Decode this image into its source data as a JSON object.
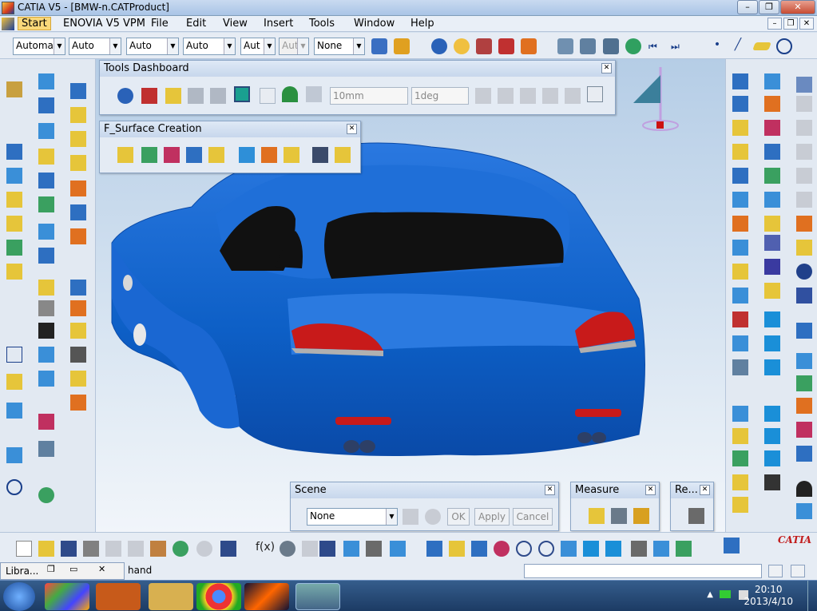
{
  "window": {
    "title": "CATIA V5 - [BMW-n.CATProduct]"
  },
  "menu": [
    "Start",
    "ENOVIA V5 VPM",
    "File",
    "Edit",
    "View",
    "Insert",
    "Tools",
    "Window",
    "Help"
  ],
  "toolbar": {
    "combos": [
      "Automa",
      "Auto",
      "Auto",
      "Auto",
      "Aut",
      "Aut",
      "None"
    ]
  },
  "tools_dashboard": {
    "title": "Tools Dashboard",
    "distance": "10mm",
    "angle": "1deg"
  },
  "fsurface": {
    "title": "F_Surface Creation"
  },
  "scene": {
    "title": "Scene",
    "value": "None",
    "ok": "OK",
    "apply": "Apply",
    "cancel": "Cancel"
  },
  "measure": {
    "title": "Measure"
  },
  "render": {
    "title": "Re..."
  },
  "status": {
    "library": "Libra...",
    "command": "hand"
  },
  "taskbar": {
    "time": "20:10",
    "date": "2013/4/10"
  },
  "brand": {
    "logo": "CATIA",
    "accent": "#1a5bc8",
    "body": "#0d62c9"
  }
}
